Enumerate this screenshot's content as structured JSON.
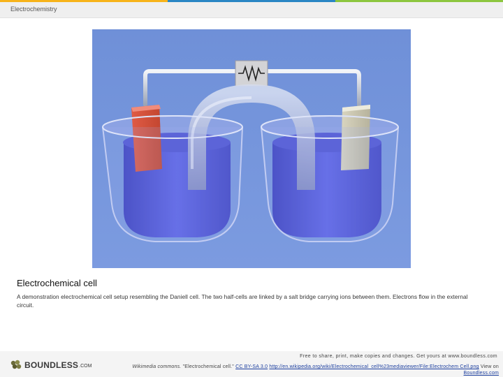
{
  "header": {
    "title": "Electrochemistry",
    "stripe_colors": [
      "#f7b31a",
      "#2a86c4",
      "#8cc63f"
    ]
  },
  "figure": {
    "alt": "Electrochemical cell illustration",
    "background_color": "#7596dc",
    "resistor_symbol": "resistor-icon"
  },
  "caption": {
    "title": "Electrochemical cell",
    "text": "A demonstration electrochemical cell setup resembling the Daniell cell. The two half-cells are linked by a salt bridge carrying ions between them. Electrons flow in the external circuit."
  },
  "footer": {
    "logo_text": "BOUNDLESS",
    "logo_suffix": ".COM",
    "free_text": "Free to share, print, make copies and changes. Get yours at www.boundless.com",
    "attribution_source": "Wikimedia commons.",
    "attribution_title": "\"Electrochemical cell.\"",
    "license_link": "CC BY-SA 3.0",
    "source_link": "http://en.wikipedia.org/wiki/Electrochemical_cell%23mediaviewer/File:Electrochem Cell.png",
    "view_on": "View on",
    "view_on_link": "Boundless.com"
  }
}
